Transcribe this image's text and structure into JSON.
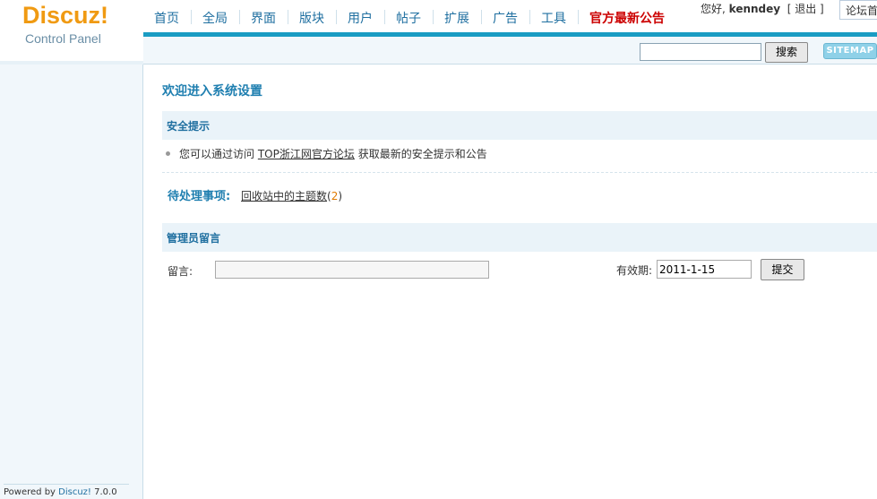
{
  "logo": {
    "brand": "Discuz",
    "bang": "!",
    "subtitle": "Control Panel"
  },
  "nav": {
    "items": [
      "首页",
      "全局",
      "界面",
      "版块",
      "用户",
      "帖子",
      "扩展",
      "广告",
      "工具"
    ],
    "hot": "官方最新公告"
  },
  "user": {
    "greeting": "您好,",
    "name": "kenndey",
    "logout": "[ 退出 ]"
  },
  "forum_box": "论坛首页",
  "search": {
    "button": "搜索",
    "sitemap": "SITEMAP",
    "value": ""
  },
  "main": {
    "title": "欢迎进入系统设置",
    "security": {
      "heading": "安全提示",
      "tip_prefix": "您可以通过访问",
      "tip_link": "TOP浙江网官方论坛",
      "tip_suffix": "获取最新的安全提示和公告"
    },
    "pending": {
      "label": "待处理事项:",
      "link": "回收站中的主题数",
      "open": "(",
      "count": "2",
      "close": ")"
    },
    "admin_note": {
      "heading": "管理员留言",
      "note_label": "留言:",
      "note_value": "",
      "expire_label": "有效期:",
      "expire_value": "2011-1-15",
      "submit": "提交"
    }
  },
  "footer": {
    "powered": "Powered by ",
    "product": "Discuz!",
    "version": " 7.0.0"
  },
  "colors": {
    "accent": "#1a9cc3",
    "brand": "#f09a12",
    "hot": "#cc0000",
    "panel": "#f1f7fb"
  }
}
